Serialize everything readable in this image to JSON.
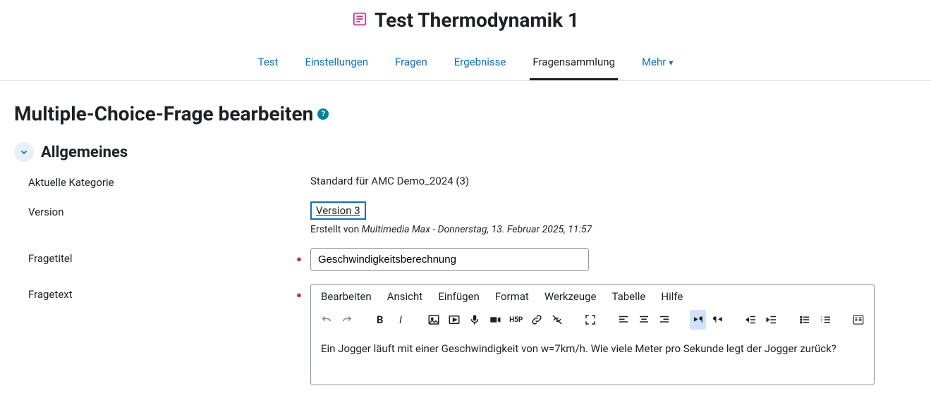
{
  "header": {
    "title": "Test Thermodynamik 1"
  },
  "tabs": {
    "test": "Test",
    "settings": "Einstellungen",
    "questions": "Fragen",
    "results": "Ergebnisse",
    "questionbank": "Fragensammlung",
    "more": "Mehr"
  },
  "page": {
    "heading": "Multiple-Choice-Frage bearbeiten"
  },
  "section_general": {
    "title": "Allgemeines",
    "category_label": "Aktuelle Kategorie",
    "category_value": "Standard für AMC Demo_2024 (3)",
    "version_label": "Version",
    "version_value": "Version 3",
    "created_prefix": "Erstellt von ",
    "created_by": "Multimedia Max - Donnerstag, 13. Februar 2025, 11:57",
    "title_label": "Fragetitel",
    "title_value": "Geschwindigkeitsberechnung",
    "text_label": "Fragetext"
  },
  "editor": {
    "menus": {
      "edit": "Bearbeiten",
      "view": "Ansicht",
      "insert": "Einfügen",
      "format": "Format",
      "tools": "Werkzeuge",
      "table": "Tabelle",
      "help": "Hilfe"
    },
    "body_text": "Ein Jogger läuft mit einer Geschwindigkeit von w=7km/h. Wie viele Meter pro Sekunde legt der Jogger zurück?"
  }
}
